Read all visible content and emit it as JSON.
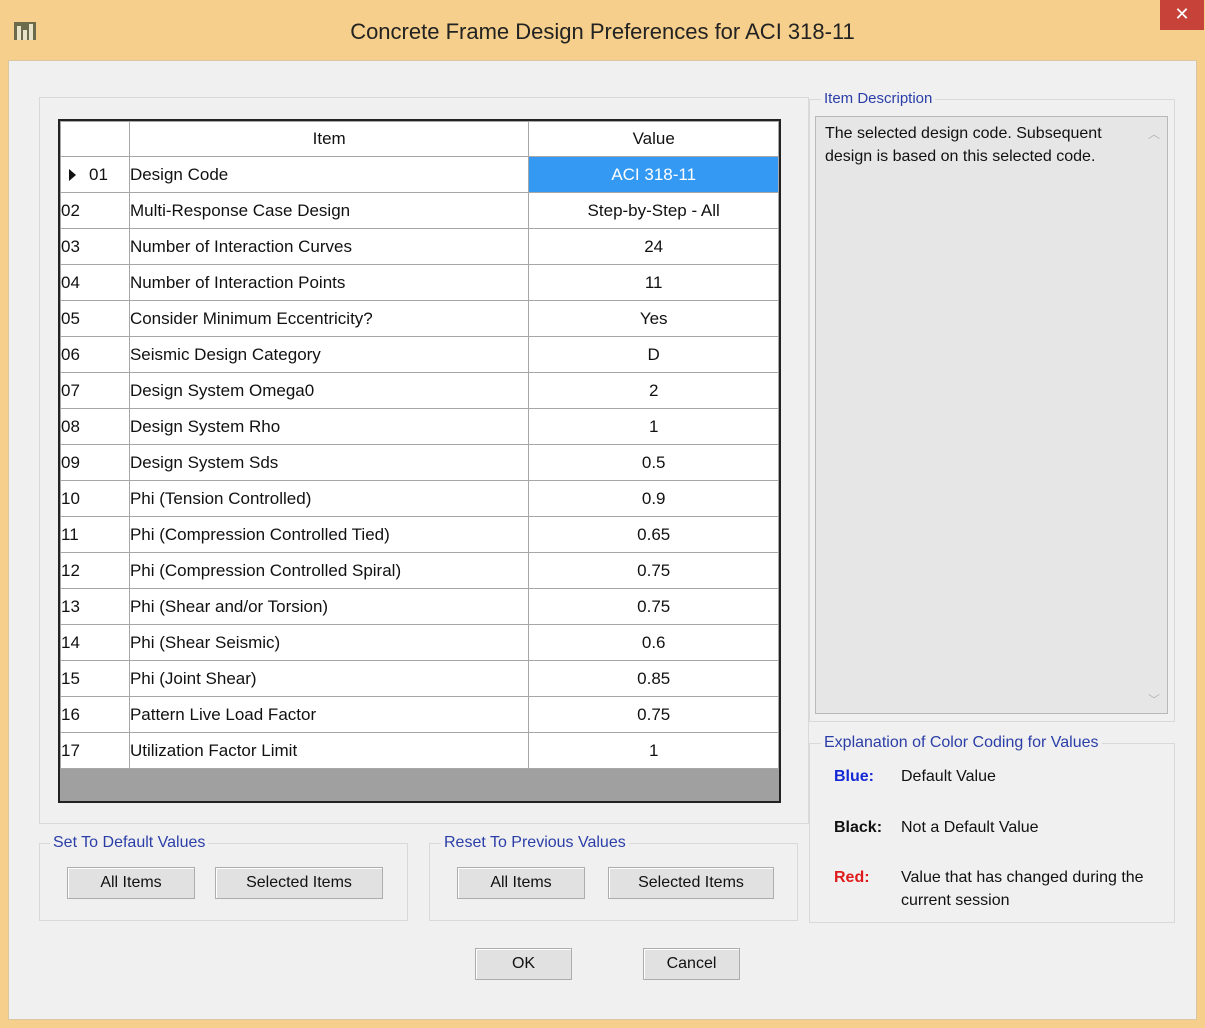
{
  "window": {
    "title": "Concrete Frame Design Preferences for ACI 318-11",
    "close_label": "✕"
  },
  "grid": {
    "headers": {
      "rownum": "",
      "item": "Item",
      "value": "Value"
    },
    "selected_row_index": 0,
    "rows": [
      {
        "num": "01",
        "item": "Design Code",
        "value": "ACI 318-11"
      },
      {
        "num": "02",
        "item": "Multi-Response Case Design",
        "value": "Step-by-Step - All"
      },
      {
        "num": "03",
        "item": "Number of Interaction Curves",
        "value": "24"
      },
      {
        "num": "04",
        "item": "Number of Interaction Points",
        "value": "11"
      },
      {
        "num": "05",
        "item": "Consider Minimum Eccentricity?",
        "value": "Yes"
      },
      {
        "num": "06",
        "item": "Seismic Design Category",
        "value": "D"
      },
      {
        "num": "07",
        "item": "Design System Omega0",
        "value": "2"
      },
      {
        "num": "08",
        "item": "Design System Rho",
        "value": "1"
      },
      {
        "num": "09",
        "item": "Design System Sds",
        "value": "0.5"
      },
      {
        "num": "10",
        "item": "Phi (Tension Controlled)",
        "value": "0.9"
      },
      {
        "num": "11",
        "item": "Phi (Compression Controlled Tied)",
        "value": "0.65"
      },
      {
        "num": "12",
        "item": "Phi (Compression Controlled Spiral)",
        "value": "0.75"
      },
      {
        "num": "13",
        "item": "Phi (Shear and/or Torsion)",
        "value": "0.75"
      },
      {
        "num": "14",
        "item": "Phi (Shear Seismic)",
        "value": "0.6"
      },
      {
        "num": "15",
        "item": "Phi (Joint Shear)",
        "value": "0.85"
      },
      {
        "num": "16",
        "item": "Pattern Live Load Factor",
        "value": "0.75"
      },
      {
        "num": "17",
        "item": "Utilization Factor Limit",
        "value": "1"
      }
    ]
  },
  "set_default": {
    "label": "Set To Default Values",
    "all_items": "All Items",
    "selected_items": "Selected Items"
  },
  "reset_previous": {
    "label": "Reset To Previous Values",
    "all_items": "All Items",
    "selected_items": "Selected Items"
  },
  "item_description": {
    "label": "Item Description",
    "text": "The selected design code. Subsequent design is based on this selected code."
  },
  "color_coding": {
    "label": "Explanation of Color Coding for Values",
    "entries": [
      {
        "key": "Blue:",
        "desc": "Default Value",
        "color": "#1428d6"
      },
      {
        "key": "Black:",
        "desc": "Not a Default Value",
        "color": "#111111"
      },
      {
        "key": "Red:",
        "desc": "Value that has changed during the current session",
        "color": "#e01b1b"
      }
    ]
  },
  "buttons": {
    "ok": "OK",
    "cancel": "Cancel"
  },
  "colors": {
    "title_bar": "#f5cf8b",
    "selection": "#3399f3",
    "default_value": "#1428d6"
  }
}
